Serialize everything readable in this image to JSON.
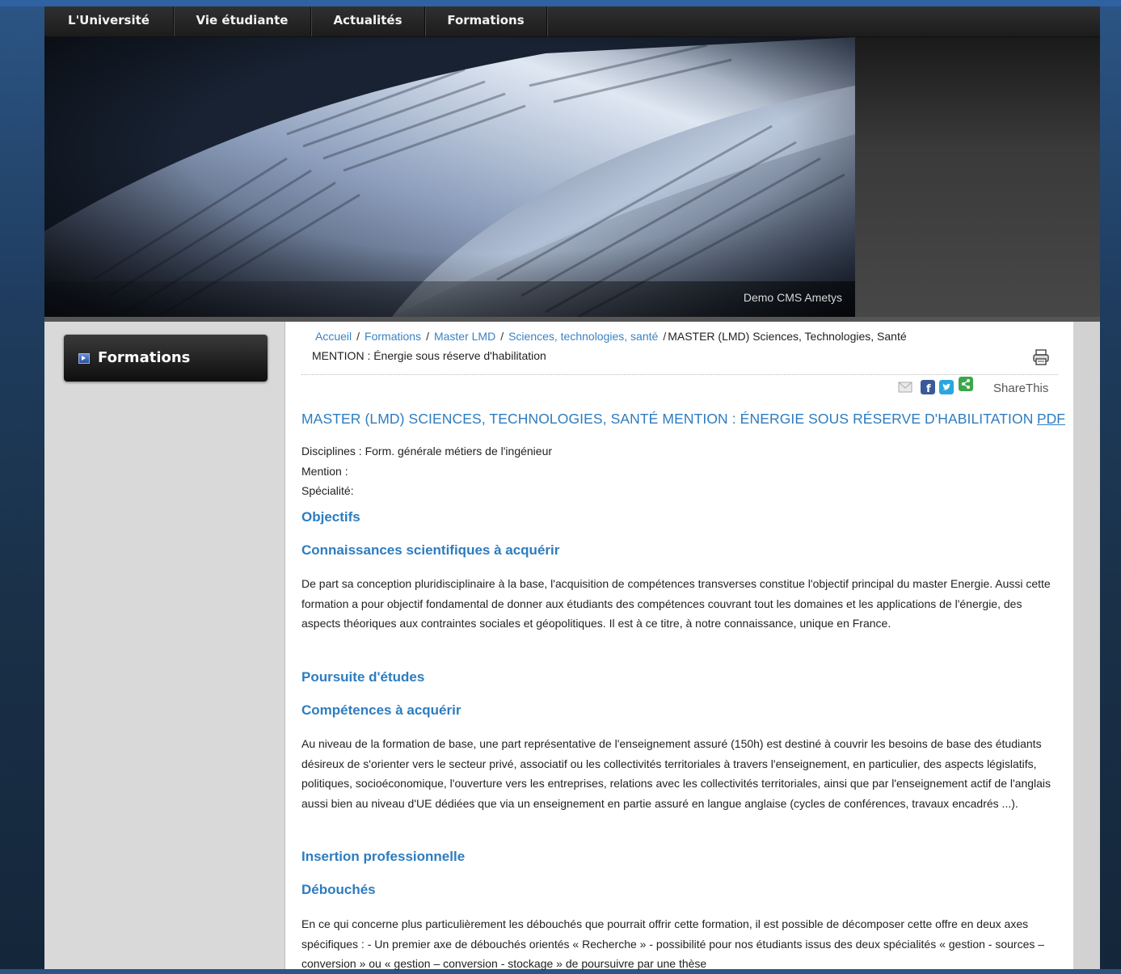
{
  "nav": {
    "items": [
      "L'Université",
      "Vie étudiante",
      "Actualités",
      "Formations"
    ]
  },
  "banner": {
    "caption": "Demo CMS Ametys"
  },
  "sidebar": {
    "title": "Formations"
  },
  "breadcrumb": {
    "links": [
      "Accueil",
      "Formations",
      "Master LMD",
      "Sciences, technologies, santé"
    ],
    "current_line1": "MASTER (LMD) Sciences, Technologies, Santé",
    "current_line2": "MENTION : Énergie sous réserve d'habilitation"
  },
  "share": {
    "label": "ShareThis"
  },
  "main": {
    "title": "MASTER (LMD) SCIENCES, TECHNOLOGIES, SANTÉ MENTION : ÉNERGIE SOUS RÉSERVE D'HABILITATION",
    "pdf_label": "PDF",
    "disciplines": "Disciplines : Form. générale métiers de l'ingénieur",
    "mention": "Mention :",
    "specialite": "Spécialité:",
    "objectifs": "Objectifs",
    "connaissances": "Connaissances scientifiques à acquérir",
    "para1": "De part sa conception pluridisciplinaire à la base, l'acquisition de compétences transverses constitue l'objectif principal du master Energie. Aussi cette formation a pour objectif fondamental de donner aux étudiants des compétences couvrant tout les domaines et les applications de l'énergie, des aspects théoriques aux contraintes sociales et géopolitiques. Il est à ce titre, à notre connaissance, unique en France.",
    "poursuite": "Poursuite d'études",
    "competences": "Compétences à acquérir",
    "para2": "Au niveau de la formation de base, une part représentative de l'enseignement assuré (150h) est destiné à couvrir les besoins de base des étudiants désireux de s'orienter vers le secteur privé, associatif ou les collectivités territoriales à travers l'enseignement, en particulier, des aspects législatifs, politiques, socioéconomique, l'ouverture vers les entreprises, relations avec les collectivités territoriales, ainsi que par l'enseignement actif de l'anglais aussi bien au niveau d'UE dédiées que via un enseignement en partie assuré en langue anglaise (cycles de conférences, travaux encadrés ...).",
    "insertion": "Insertion professionnelle",
    "debouches": "Débouchés",
    "para3": "En ce qui concerne plus particulièrement les débouchés que pourrait offrir cette formation, il est possible de décomposer cette offre en deux axes spécifiques : - Un premier axe de débouchés orientés « Recherche » - possibilité pour nos étudiants issus des deux spécialités « gestion - sources – conversion » ou « gestion – conversion - stockage » de poursuivre par une thèse"
  },
  "colors": {
    "link": "#3b82c4",
    "heading": "#2d7cc0",
    "nav_bg": "#252525"
  }
}
